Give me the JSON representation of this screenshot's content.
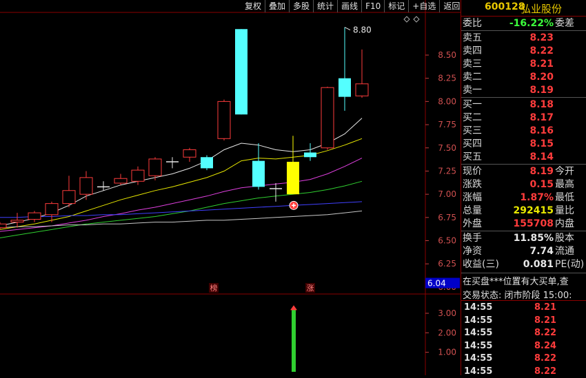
{
  "toolbar": [
    "复权",
    "叠加",
    "多股",
    "统计",
    "画线",
    "F10",
    "标记",
    "+自选",
    "返回"
  ],
  "stock": {
    "code": "600128",
    "name": "弘业股份"
  },
  "quote_rows": [
    {
      "label": "委比",
      "value": "-16.22%",
      "color": "#3cff3c",
      "label2": "委差"
    },
    {
      "label": "卖五",
      "value": "8.23",
      "color": "#ff3c3c",
      "label2": ""
    },
    {
      "label": "卖四",
      "value": "8.22",
      "color": "#ff3c3c",
      "label2": ""
    },
    {
      "label": "卖三",
      "value": "8.21",
      "color": "#ff3c3c",
      "label2": ""
    },
    {
      "label": "卖二",
      "value": "8.20",
      "color": "#ff3c3c",
      "label2": ""
    },
    {
      "label": "卖一",
      "value": "8.19",
      "color": "#ff3c3c",
      "label2": ""
    },
    {
      "label": "买一",
      "value": "8.18",
      "color": "#ff3c3c",
      "label2": ""
    },
    {
      "label": "买二",
      "value": "8.17",
      "color": "#ff3c3c",
      "label2": ""
    },
    {
      "label": "买三",
      "value": "8.16",
      "color": "#ff3c3c",
      "label2": ""
    },
    {
      "label": "买四",
      "value": "8.15",
      "color": "#ff3c3c",
      "label2": ""
    },
    {
      "label": "买五",
      "value": "8.14",
      "color": "#ff3c3c",
      "label2": ""
    },
    {
      "label": "现价",
      "value": "8.19",
      "color": "#ff3c3c",
      "label2": "今开"
    },
    {
      "label": "涨跌",
      "value": "0.15",
      "color": "#ff3c3c",
      "label2": "最高"
    },
    {
      "label": "涨幅",
      "value": "1.87%",
      "color": "#ff3c3c",
      "label2": "最低"
    },
    {
      "label": "总量",
      "value": "292415",
      "color": "#e8e800",
      "label2": "量比"
    },
    {
      "label": "外盘",
      "value": "155708",
      "color": "#ff3c3c",
      "label2": "内盘"
    },
    {
      "label": "换手",
      "value": "11.85%",
      "color": "#e8e8e8",
      "label2": "股本"
    },
    {
      "label": "净资",
      "value": "7.74",
      "color": "#e8e8e8",
      "label2": "流通"
    },
    {
      "label": "收益(三)",
      "value": "0.081",
      "color": "#e8e8e8",
      "label2": "PE(动)"
    }
  ],
  "messages": [
    "在买盘***位置有大买单,查",
    "交易状态: 闭市阶段 15:00:"
  ],
  "ticks": [
    {
      "time": "14:55",
      "price": "8.21"
    },
    {
      "time": "14:55",
      "price": "8.21"
    },
    {
      "time": "14:55",
      "price": "8.22"
    },
    {
      "time": "14:55",
      "price": "8.24"
    },
    {
      "time": "14:55",
      "price": "8.22"
    },
    {
      "time": "14:55",
      "price": "8.22"
    }
  ],
  "chart_data": {
    "type": "candlestick",
    "price_ticks": [
      "8.50",
      "8.25",
      "8.00",
      "7.75",
      "7.50",
      "7.25",
      "7.00",
      "6.75",
      "6.50",
      "6.25",
      "6.00"
    ],
    "price_range": [
      5.94,
      8.96
    ],
    "volume_ticks": [
      "3.00",
      "2.00",
      "1.00"
    ],
    "volume_range": [
      0,
      3.6
    ],
    "cursor_price_label": "6.04",
    "high_marker": "8.80",
    "markers": [
      {
        "label": "榜",
        "index": 12
      },
      {
        "label": "涨",
        "index": 18
      }
    ],
    "candles": [
      {
        "o": 6.64,
        "c": 6.68,
        "h": 6.7,
        "l": 6.62
      },
      {
        "o": 6.7,
        "c": 6.72,
        "h": 6.8,
        "l": 6.64
      },
      {
        "o": 6.73,
        "c": 6.8,
        "h": 6.82,
        "l": 6.7
      },
      {
        "o": 6.78,
        "c": 6.9,
        "h": 6.92,
        "l": 6.7
      },
      {
        "o": 6.9,
        "c": 7.04,
        "h": 7.2,
        "l": 6.86
      },
      {
        "o": 7.0,
        "c": 7.18,
        "h": 7.25,
        "l": 6.94
      },
      {
        "o": 7.08,
        "c": 7.08,
        "h": 7.14,
        "l": 7.04
      },
      {
        "o": 7.12,
        "c": 7.17,
        "h": 7.22,
        "l": 7.1
      },
      {
        "o": 7.14,
        "c": 7.26,
        "h": 7.3,
        "l": 7.1
      },
      {
        "o": 7.2,
        "c": 7.38,
        "h": 7.4,
        "l": 7.15
      },
      {
        "o": 7.35,
        "c": 7.35,
        "h": 7.4,
        "l": 7.28
      },
      {
        "o": 7.4,
        "c": 7.48,
        "h": 7.5,
        "l": 7.35
      },
      {
        "o": 7.4,
        "c": 7.28,
        "h": 7.42,
        "l": 7.26
      },
      {
        "o": 7.6,
        "c": 8.0,
        "h": 8.02,
        "l": 7.58
      },
      {
        "o": 8.78,
        "c": 7.86,
        "h": 8.78,
        "l": 7.86
      },
      {
        "o": 7.36,
        "c": 7.08,
        "h": 7.55,
        "l": 7.05
      },
      {
        "o": 7.06,
        "c": 7.06,
        "h": 7.12,
        "l": 6.92
      },
      {
        "o": 7.35,
        "c": 7.0,
        "h": 7.63,
        "l": 7.0
      },
      {
        "o": 7.45,
        "c": 7.4,
        "h": 7.55,
        "l": 7.36
      },
      {
        "o": 7.5,
        "c": 8.15,
        "h": 8.16,
        "l": 7.48
      },
      {
        "o": 8.25,
        "c": 8.05,
        "h": 8.8,
        "l": 7.9
      },
      {
        "o": 8.06,
        "c": 8.19,
        "h": 8.56,
        "l": 8.04
      }
    ],
    "ma": [
      {
        "color": "#e8e8e8",
        "values": [
          6.66,
          6.7,
          6.74,
          6.8,
          6.88,
          6.98,
          7.04,
          7.1,
          7.14,
          7.18,
          7.22,
          7.28,
          7.36,
          7.48,
          7.55,
          7.53,
          7.48,
          7.46,
          7.48,
          7.55,
          7.65,
          7.82
        ]
      },
      {
        "color": "#e8e800",
        "values": [
          6.62,
          6.65,
          6.68,
          6.72,
          6.76,
          6.82,
          6.88,
          6.94,
          6.99,
          7.04,
          7.08,
          7.13,
          7.18,
          7.25,
          7.36,
          7.39,
          7.38,
          7.4,
          7.42,
          7.47,
          7.53,
          7.6
        ]
      },
      {
        "color": "#e040e0",
        "values": [
          6.6,
          6.62,
          6.64,
          6.66,
          6.69,
          6.72,
          6.76,
          6.79,
          6.83,
          6.86,
          6.9,
          6.94,
          6.98,
          7.03,
          7.07,
          7.09,
          7.11,
          7.13,
          7.16,
          7.22,
          7.3,
          7.39
        ]
      },
      {
        "color": "#30d030",
        "values": [
          6.53,
          6.56,
          6.59,
          6.62,
          6.65,
          6.68,
          6.7,
          6.72,
          6.74,
          6.76,
          6.79,
          6.82,
          6.86,
          6.9,
          6.93,
          6.96,
          6.98,
          7.0,
          7.02,
          7.05,
          7.09,
          7.14
        ]
      },
      {
        "color": "#4040ff",
        "values": [
          6.75,
          6.75,
          6.76,
          6.76,
          6.77,
          6.77,
          6.78,
          6.78,
          6.79,
          6.8,
          6.81,
          6.82,
          6.83,
          6.84,
          6.85,
          6.86,
          6.87,
          6.88,
          6.89,
          6.9,
          6.91,
          6.92
        ]
      },
      {
        "color": "#c8c8c8",
        "values": [
          6.64,
          6.65,
          6.65,
          6.66,
          6.67,
          6.67,
          6.68,
          6.68,
          6.69,
          6.7,
          6.7,
          6.71,
          6.72,
          6.72,
          6.73,
          6.74,
          6.75,
          6.76,
          6.77,
          6.78,
          6.8,
          6.82
        ]
      }
    ],
    "volume_bar": {
      "index": 17,
      "value": 3.2,
      "color": "#30d030"
    }
  }
}
